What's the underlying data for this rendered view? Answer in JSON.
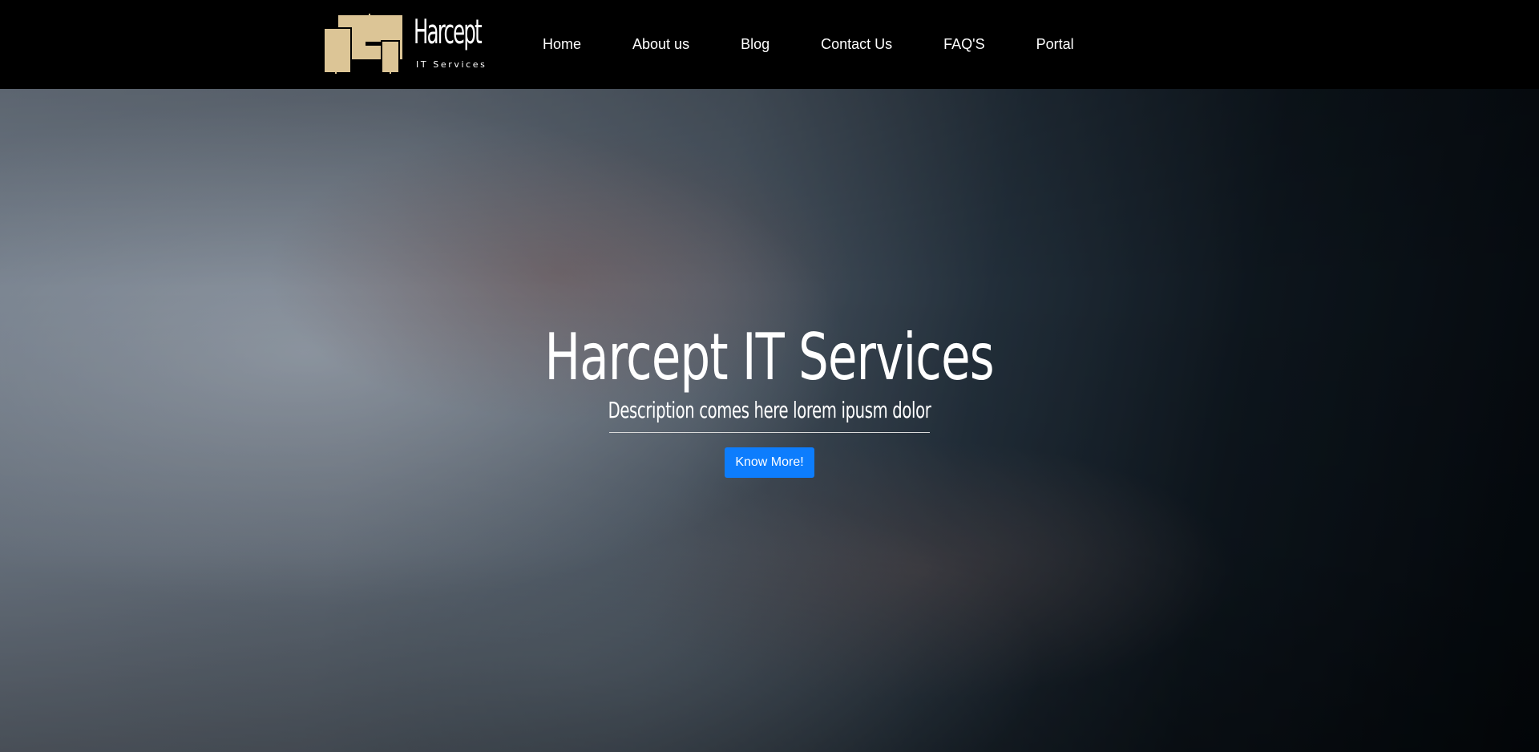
{
  "brand": {
    "title": "Harcept",
    "subtitle": "IT Services",
    "logo_color": "#dcc596"
  },
  "nav": {
    "items": [
      {
        "label": "Home"
      },
      {
        "label": "About us"
      },
      {
        "label": "Blog"
      },
      {
        "label": "Contact Us"
      },
      {
        "label": "FAQ'S"
      },
      {
        "label": "Portal"
      }
    ]
  },
  "hero": {
    "title": "Harcept IT Services",
    "description": "Description comes here lorem ipusm dolor",
    "button_label": "Know More!",
    "button_color": "#0d7dfd"
  }
}
